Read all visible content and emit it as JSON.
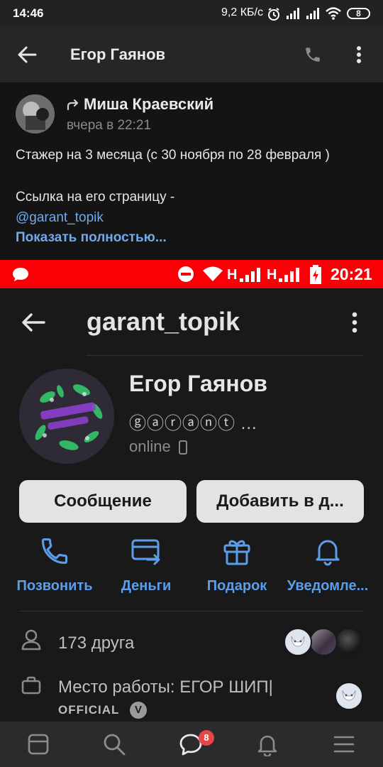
{
  "status_bar": {
    "time": "14:46",
    "speed": "9,2 КБ/с",
    "battery": "8"
  },
  "header": {
    "title": "Егор Гаянов"
  },
  "post": {
    "author": "Миша Краевский",
    "time": "вчера в 22:21",
    "line1": "Стажер на  3 месяца (с 30 ноября по 28 февраля )",
    "line2": "Ссылка на его страницу -",
    "link": "@garant_topik",
    "show_more": "Показать полностью..."
  },
  "screenshot": {
    "status_time": "20:21",
    "net1": "H",
    "net2": "H",
    "title": "garant_topik",
    "profile": {
      "name": "Егор Гаянов",
      "status": "ⓖⓐⓡⓐⓝⓣ ...",
      "online": "online"
    },
    "buttons": {
      "message": "Сообщение",
      "add_friend": "Добавить в д..."
    },
    "actions": [
      "Позвонить",
      "Деньги",
      "Подарок",
      "Уведомле..."
    ],
    "friends": "173 друга",
    "work_label": "Место работы: ЕГОР ШИП|",
    "work_official": "OFFICIAL",
    "verified": "V"
  },
  "nav": {
    "badge": "8"
  },
  "colors": {
    "accent": "#71aaeb",
    "action_blue": "#5b9de9",
    "embedded_status_red": "#f80006",
    "badge_red": "#e64646"
  }
}
